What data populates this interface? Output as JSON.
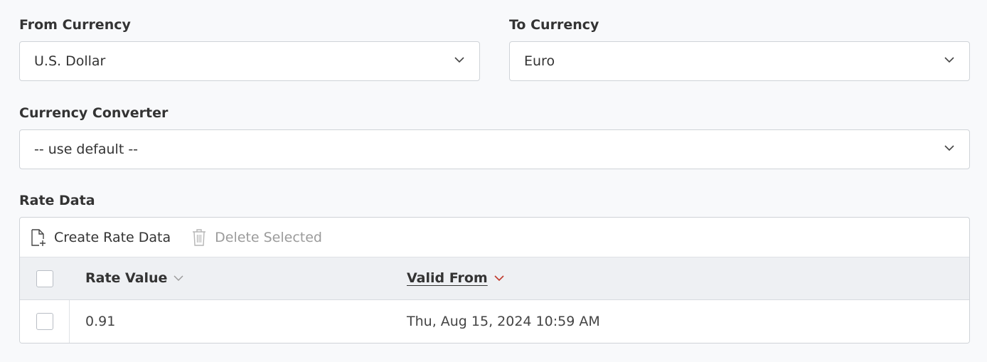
{
  "from_currency": {
    "label": "From Currency",
    "value": "U.S. Dollar",
    "icon": "chevron-down-icon"
  },
  "to_currency": {
    "label": "To Currency",
    "value": "Euro",
    "icon": "chevron-down-icon"
  },
  "currency_converter": {
    "label": "Currency Converter",
    "value": "-- use default --",
    "icon": "chevron-down-icon"
  },
  "rate_data": {
    "label": "Rate Data",
    "toolbar": {
      "create_label": "Create Rate Data",
      "create_icon": "new-document-icon",
      "delete_label": "Delete Selected",
      "delete_icon": "trash-icon"
    },
    "columns": [
      {
        "label": "Rate Value",
        "sort": "none"
      },
      {
        "label": "Valid From",
        "sort": "descending"
      }
    ],
    "rows": [
      {
        "rate_value": "0.91",
        "valid_from": "Thu, Aug 15, 2024 10:59 AM"
      }
    ]
  },
  "colors": {
    "background": "#f8f9fb",
    "border": "#cfd3d8",
    "header_bg": "#eef0f3",
    "sort_active": "#c0392b",
    "disabled_text": "#9b9b9b"
  }
}
